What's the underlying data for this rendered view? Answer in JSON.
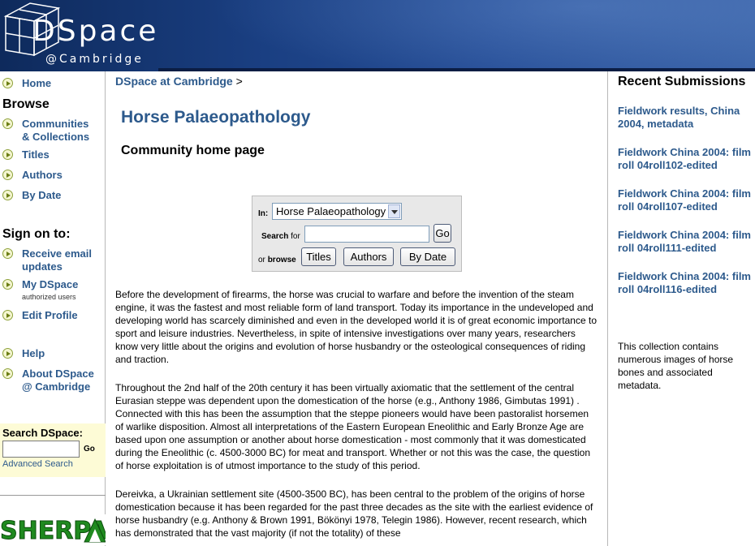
{
  "header": {
    "logo_word": "DSpace",
    "logo_sub": "@Cambridge"
  },
  "left_nav": {
    "home": "Home",
    "browse_heading": "Browse",
    "communities": "Communities & Collections",
    "titles": "Titles",
    "authors": "Authors",
    "by_date": "By Date",
    "sign_on_heading": "Sign on to:",
    "receive_email": "Receive email updates",
    "my_dspace": "My DSpace",
    "my_dspace_note": "authorized users",
    "edit_profile": "Edit Profile",
    "help": "Help",
    "about": "About DSpace @ Cambridge",
    "search_label": "Search DSpace:",
    "search_go": "Go",
    "advanced_search": "Advanced Search",
    "sherpa_text": "SHERPA"
  },
  "breadcrumb": {
    "link": "DSpace at Cambridge",
    "separator": ">"
  },
  "main": {
    "title": "Horse Palaeopathology",
    "subtitle": "Community home page",
    "search": {
      "in_label": "In:",
      "scope_value": "Horse Palaeopathology",
      "search_for_label": "Search",
      "search_for_suffix": "for",
      "query_value": "",
      "go_label": "Go",
      "or_label": "or",
      "browse_label": "browse",
      "browse_titles": "Titles",
      "browse_authors": "Authors",
      "browse_by_date": "By Date"
    },
    "paragraphs": [
      "Before the development of firearms, the horse was crucial to warfare and before the invention of the steam engine, it was the fastest and most reliable form of land transport. Today its importance in the undeveloped and developing world has scarcely diminished and even in the developed world it is of great economic importance to sport and leisure industries. Nevertheless, in spite of intensive investigations over many years, researchers know very little about the origins and evolution of horse husbandry or the osteological consequences of riding and traction.",
      "Throughout the 2nd half of the 20th century it has been virtually axiomatic that the settlement of the central Eurasian steppe was dependent upon the domestication of the horse (e.g., Anthony 1986, Gimbutas 1991) . Connected with this has been the assumption that the steppe pioneers would have been pastoralist horsemen of warlike disposition. Almost all interpretations of the Eastern European Eneolithic and Early Bronze Age are based upon one assumption or another about horse domestication - most commonly that it was domesticated during the Eneolithic (c. 4500-3000 BC) for meat and transport. Whether or not this was the case, the question of horse exploitation is of utmost importance to the study of this period.",
      "Dereivka, a Ukrainian settlement site (4500-3500 BC), has been central to the problem of the origins of horse domestication because it has been regarded for the past three decades as the site with the earliest evidence of horse husbandry (e.g. Anthony & Brown 1991, Bökönyi 1978, Telegin 1986). However, recent research, which has demonstrated that the vast majority (if not the totality) of these"
    ]
  },
  "right_col": {
    "heading": "Recent Submissions",
    "items": [
      "Fieldwork results, China 2004, metadata",
      "Fieldwork China 2004: film roll 04roll102-edited",
      "Fieldwork China 2004: film roll 04roll107-edited",
      "Fieldwork China 2004: film roll 04roll111-edited",
      "Fieldwork China 2004: film roll 04roll116-edited"
    ],
    "description": "This collection contains numerous images of horse bones and associated metadata."
  },
  "colors": {
    "link": "#2d5a8c",
    "header_dark": "#0e2a5c",
    "search_box_bg": "#fdfbd6",
    "sherpa_green": "#1f8a1f"
  }
}
